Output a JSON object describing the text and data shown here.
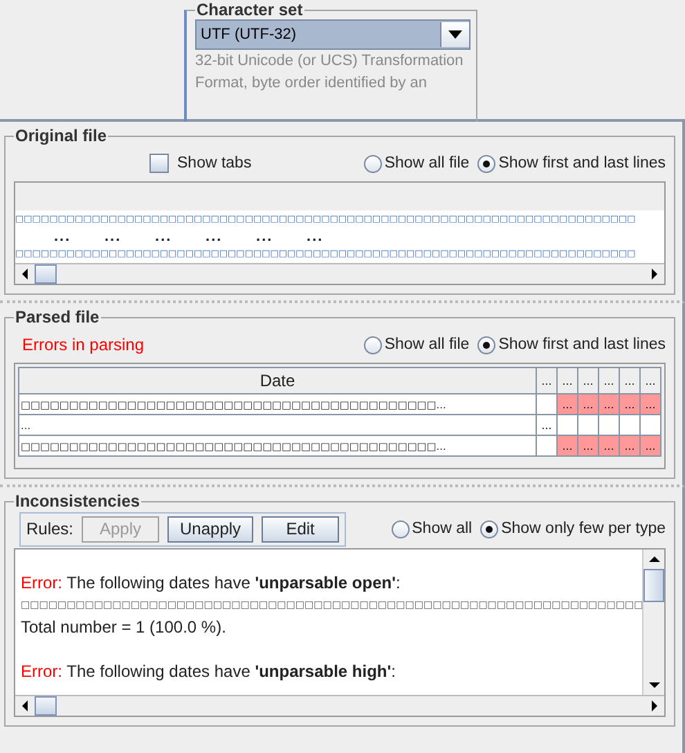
{
  "character_set": {
    "title": "Character set",
    "value": "UTF (UTF-32)",
    "description": [
      "32-bit Unicode (or UCS) Transformation",
      "Format, byte order identified by an"
    ]
  },
  "original_file": {
    "title": "Original file",
    "show_tabs": {
      "label": "Show tabs",
      "checked": false
    },
    "options": [
      {
        "label": "Show all file",
        "selected": false
      },
      {
        "label": "Show first and last lines",
        "selected": true
      }
    ],
    "lines": [
      {
        "kind": "boxes",
        "text": "□□□□□□□□□□□□□□□□□□□□□□□□□□□□□□□□□□□□□□□□□□□□□□□□□□□□□□□□□□□□□□□□□□□□□□□□□"
      },
      {
        "kind": "gap",
        "text": "...      ...      ...      ...      ...      ..."
      },
      {
        "kind": "boxes",
        "text": "□□□□□□□□□□□□□□□□□□□□□□□□□□□□□□□□□□□□□□□□□□□□□□□□□□□□□□□□□□□□□□□□□□□□□□□□□"
      }
    ]
  },
  "parsed_file": {
    "title": "Parsed file",
    "status": "Errors in parsing",
    "options": [
      {
        "label": "Show all file",
        "selected": false
      },
      {
        "label": "Show first and last lines",
        "selected": true
      }
    ],
    "columns": [
      "Date",
      "...",
      "...",
      "...",
      "...",
      "...",
      "..."
    ],
    "rows": [
      {
        "cells": [
          {
            "text": "□□□□□□□□□□□□□□□□□□□□□□□□□□□□□□□□□□□□□□□□□□□...",
            "error": false
          },
          {
            "text": "",
            "error": false
          },
          {
            "text": "...",
            "error": true
          },
          {
            "text": "...",
            "error": true
          },
          {
            "text": "...",
            "error": true
          },
          {
            "text": "...",
            "error": true
          },
          {
            "text": "...",
            "error": true
          }
        ]
      },
      {
        "cells": [
          {
            "text": "...",
            "error": false
          },
          {
            "text": "...",
            "error": false
          },
          {
            "text": "",
            "error": false
          },
          {
            "text": "",
            "error": false
          },
          {
            "text": "",
            "error": false
          },
          {
            "text": "",
            "error": false
          },
          {
            "text": "",
            "error": false
          }
        ]
      },
      {
        "cells": [
          {
            "text": "□□□□□□□□□□□□□□□□□□□□□□□□□□□□□□□□□□□□□□□□□□□...",
            "error": false
          },
          {
            "text": "",
            "error": false
          },
          {
            "text": "...",
            "error": true
          },
          {
            "text": "...",
            "error": true
          },
          {
            "text": "...",
            "error": true
          },
          {
            "text": "...",
            "error": true
          },
          {
            "text": "...",
            "error": true
          }
        ]
      }
    ]
  },
  "inconsistencies": {
    "title": "Inconsistencies",
    "rules_label": "Rules:",
    "buttons": [
      {
        "label": "Apply",
        "disabled": true
      },
      {
        "label": "Unapply",
        "disabled": false
      },
      {
        "label": "Edit",
        "disabled": false
      }
    ],
    "options": [
      {
        "label": "Show all",
        "selected": false
      },
      {
        "label": "Show only few per type",
        "selected": true
      }
    ],
    "lines": [
      {
        "kind": "blank"
      },
      {
        "kind": "error",
        "label": "Error:",
        "text": "The following dates have **'unparsable open'**:"
      },
      {
        "kind": "boxes",
        "text": "□□□□□□□□□□□□□□□□□□□□□□□□□□□□□□□□□□□□□□□□□□□□□□□□□□□□□□□□□□□□□□□□□□□□"
      },
      {
        "kind": "plain",
        "text": "Total number = 1 (100.0 %)."
      },
      {
        "kind": "blank"
      },
      {
        "kind": "error",
        "label": "Error:",
        "text": "The following dates have **'unparsable high'**:"
      }
    ]
  }
}
